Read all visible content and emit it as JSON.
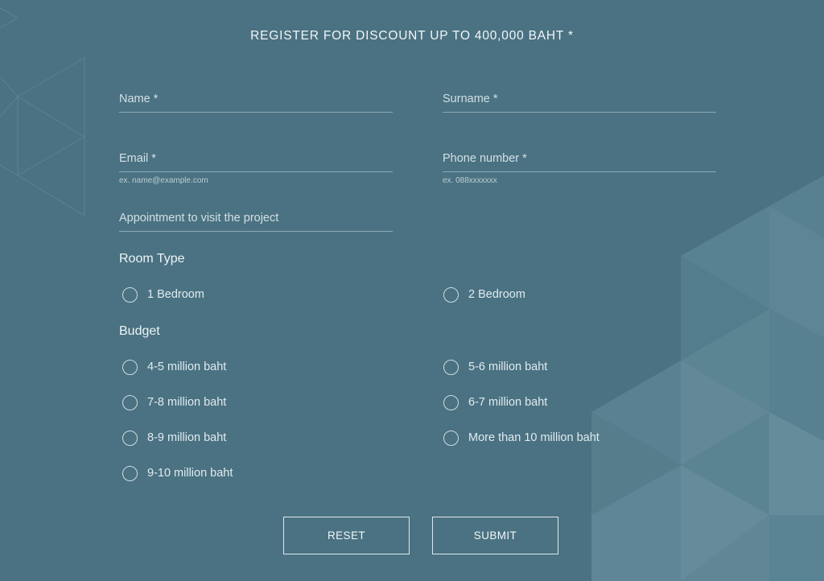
{
  "form": {
    "title": "REGISTER FOR DISCOUNT UP TO 400,000 BAHT *",
    "fields": {
      "name": {
        "placeholder": "Name *",
        "value": ""
      },
      "surname": {
        "placeholder": "Surname *",
        "value": ""
      },
      "email": {
        "placeholder": "Email *",
        "value": "",
        "hint": "ex. name@example.com"
      },
      "phone": {
        "placeholder": "Phone number *",
        "value": "",
        "hint": "ex. 088xxxxxxx"
      },
      "appointment": {
        "placeholder": "Appointment to visit the project",
        "value": ""
      }
    },
    "room_type": {
      "heading": "Room Type",
      "options": [
        "1 Bedroom",
        "2 Bedroom"
      ]
    },
    "budget": {
      "heading": "Budget",
      "options": [
        "4-5 million baht",
        "5-6 million baht",
        "7-8 million baht",
        "6-7 million baht",
        "8-9 million baht",
        "More than 10 million baht",
        "9-10 million baht"
      ]
    },
    "buttons": {
      "reset": "RESET",
      "submit": "SUBMIT"
    }
  },
  "colors": {
    "background": "#4a7282",
    "text": "#e6eef1",
    "pattern_light": "#6b909e"
  }
}
